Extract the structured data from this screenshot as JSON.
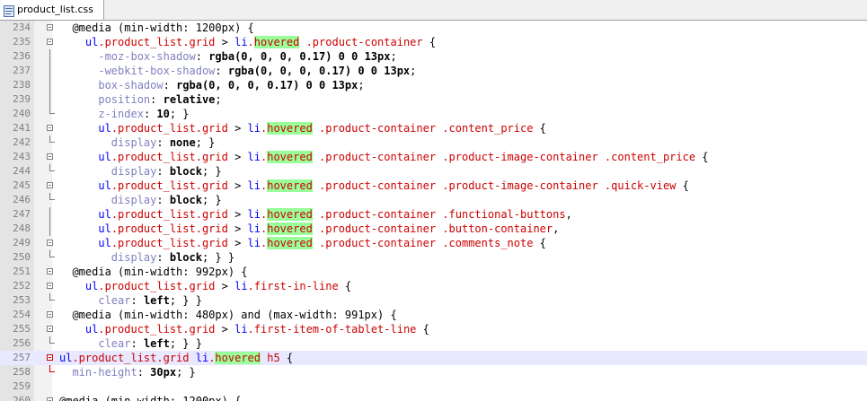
{
  "tab": {
    "label": "product_list.css",
    "icon": "css-file-icon"
  },
  "lines": [
    {
      "num": "234",
      "fold": "box",
      "tokens": [
        [
          "t",
          "  @media (min-width: 1200px) {"
        ]
      ]
    },
    {
      "num": "235",
      "fold": "box",
      "tokens": [
        [
          "t",
          "    "
        ],
        [
          "s",
          "ul"
        ],
        [
          "c",
          ".product_list.grid"
        ],
        [
          "t",
          " > "
        ],
        [
          "s",
          "li"
        ],
        [
          "c",
          "."
        ],
        [
          "h",
          "hovered"
        ],
        [
          "c",
          " .product-container"
        ],
        [
          "t",
          " {"
        ]
      ]
    },
    {
      "num": "236",
      "fold": "line",
      "tokens": [
        [
          "t",
          "      "
        ],
        [
          "p",
          "-moz-box-shadow"
        ],
        [
          "t",
          ": "
        ],
        [
          "v",
          "rgba(0, 0, 0, 0.17) 0 0 13px"
        ],
        [
          "t",
          ";"
        ]
      ]
    },
    {
      "num": "237",
      "fold": "line",
      "tokens": [
        [
          "t",
          "      "
        ],
        [
          "p",
          "-webkit-box-shadow"
        ],
        [
          "t",
          ": "
        ],
        [
          "v",
          "rgba(0, 0, 0, 0.17) 0 0 13px"
        ],
        [
          "t",
          ";"
        ]
      ]
    },
    {
      "num": "238",
      "fold": "line",
      "tokens": [
        [
          "t",
          "      "
        ],
        [
          "p",
          "box-shadow"
        ],
        [
          "t",
          ": "
        ],
        [
          "v",
          "rgba(0, 0, 0, 0.17) 0 0 13px"
        ],
        [
          "t",
          ";"
        ]
      ]
    },
    {
      "num": "239",
      "fold": "line",
      "tokens": [
        [
          "t",
          "      "
        ],
        [
          "p",
          "position"
        ],
        [
          "t",
          ": "
        ],
        [
          "v",
          "relative"
        ],
        [
          "t",
          ";"
        ]
      ]
    },
    {
      "num": "240",
      "fold": "corner",
      "tokens": [
        [
          "t",
          "      "
        ],
        [
          "p",
          "z-index"
        ],
        [
          "t",
          ": "
        ],
        [
          "v",
          "10"
        ],
        [
          "t",
          "; }"
        ]
      ]
    },
    {
      "num": "241",
      "fold": "box",
      "tokens": [
        [
          "t",
          "      "
        ],
        [
          "s",
          "ul"
        ],
        [
          "c",
          ".product_list.grid"
        ],
        [
          "t",
          " > "
        ],
        [
          "s",
          "li"
        ],
        [
          "c",
          "."
        ],
        [
          "h",
          "hovered"
        ],
        [
          "c",
          " .product-container .content_price"
        ],
        [
          "t",
          " {"
        ]
      ]
    },
    {
      "num": "242",
      "fold": "corner",
      "tokens": [
        [
          "t",
          "        "
        ],
        [
          "p",
          "display"
        ],
        [
          "t",
          ": "
        ],
        [
          "v",
          "none"
        ],
        [
          "t",
          "; }"
        ]
      ]
    },
    {
      "num": "243",
      "fold": "box",
      "tokens": [
        [
          "t",
          "      "
        ],
        [
          "s",
          "ul"
        ],
        [
          "c",
          ".product_list.grid"
        ],
        [
          "t",
          " > "
        ],
        [
          "s",
          "li"
        ],
        [
          "c",
          "."
        ],
        [
          "h",
          "hovered"
        ],
        [
          "c",
          " .product-container .product-image-container .content_price"
        ],
        [
          "t",
          " {"
        ]
      ]
    },
    {
      "num": "244",
      "fold": "corner",
      "tokens": [
        [
          "t",
          "        "
        ],
        [
          "p",
          "display"
        ],
        [
          "t",
          ": "
        ],
        [
          "v",
          "block"
        ],
        [
          "t",
          "; }"
        ]
      ]
    },
    {
      "num": "245",
      "fold": "box",
      "tokens": [
        [
          "t",
          "      "
        ],
        [
          "s",
          "ul"
        ],
        [
          "c",
          ".product_list.grid"
        ],
        [
          "t",
          " > "
        ],
        [
          "s",
          "li"
        ],
        [
          "c",
          "."
        ],
        [
          "h",
          "hovered"
        ],
        [
          "c",
          " .product-container .product-image-container .quick-view"
        ],
        [
          "t",
          " {"
        ]
      ]
    },
    {
      "num": "246",
      "fold": "corner",
      "tokens": [
        [
          "t",
          "        "
        ],
        [
          "p",
          "display"
        ],
        [
          "t",
          ": "
        ],
        [
          "v",
          "block"
        ],
        [
          "t",
          "; }"
        ]
      ]
    },
    {
      "num": "247",
      "fold": "line",
      "tokens": [
        [
          "t",
          "      "
        ],
        [
          "s",
          "ul"
        ],
        [
          "c",
          ".product_list.grid"
        ],
        [
          "t",
          " > "
        ],
        [
          "s",
          "li"
        ],
        [
          "c",
          "."
        ],
        [
          "h",
          "hovered"
        ],
        [
          "c",
          " .product-container .functional-buttons"
        ],
        [
          "t",
          ","
        ]
      ]
    },
    {
      "num": "248",
      "fold": "line",
      "tokens": [
        [
          "t",
          "      "
        ],
        [
          "s",
          "ul"
        ],
        [
          "c",
          ".product_list.grid"
        ],
        [
          "t",
          " > "
        ],
        [
          "s",
          "li"
        ],
        [
          "c",
          "."
        ],
        [
          "h",
          "hovered"
        ],
        [
          "c",
          " .product-container .button-container"
        ],
        [
          "t",
          ","
        ]
      ]
    },
    {
      "num": "249",
      "fold": "box",
      "tokens": [
        [
          "t",
          "      "
        ],
        [
          "s",
          "ul"
        ],
        [
          "c",
          ".product_list.grid"
        ],
        [
          "t",
          " > "
        ],
        [
          "s",
          "li"
        ],
        [
          "c",
          "."
        ],
        [
          "h",
          "hovered"
        ],
        [
          "c",
          " .product-container .comments_note"
        ],
        [
          "t",
          " {"
        ]
      ]
    },
    {
      "num": "250",
      "fold": "corner",
      "tokens": [
        [
          "t",
          "        "
        ],
        [
          "p",
          "display"
        ],
        [
          "t",
          ": "
        ],
        [
          "v",
          "block"
        ],
        [
          "t",
          "; } }"
        ]
      ]
    },
    {
      "num": "251",
      "fold": "box",
      "tokens": [
        [
          "t",
          "  @media (min-width: 992px) {"
        ]
      ]
    },
    {
      "num": "252",
      "fold": "box",
      "tokens": [
        [
          "t",
          "    "
        ],
        [
          "s",
          "ul"
        ],
        [
          "c",
          ".product_list.grid"
        ],
        [
          "t",
          " > "
        ],
        [
          "s",
          "li"
        ],
        [
          "c",
          ".first-in-line"
        ],
        [
          "t",
          " {"
        ]
      ]
    },
    {
      "num": "253",
      "fold": "corner",
      "tokens": [
        [
          "t",
          "      "
        ],
        [
          "p",
          "clear"
        ],
        [
          "t",
          ": "
        ],
        [
          "v",
          "left"
        ],
        [
          "t",
          "; } }"
        ]
      ]
    },
    {
      "num": "254",
      "fold": "box",
      "tokens": [
        [
          "t",
          "  @media (min-width: 480px) and (max-width: 991px) {"
        ]
      ]
    },
    {
      "num": "255",
      "fold": "box",
      "tokens": [
        [
          "t",
          "    "
        ],
        [
          "s",
          "ul"
        ],
        [
          "c",
          ".product_list.grid"
        ],
        [
          "t",
          " > "
        ],
        [
          "s",
          "li"
        ],
        [
          "c",
          ".first-item-of-tablet-line"
        ],
        [
          "t",
          " {"
        ]
      ]
    },
    {
      "num": "256",
      "fold": "corner",
      "tokens": [
        [
          "t",
          "      "
        ],
        [
          "p",
          "clear"
        ],
        [
          "t",
          ": "
        ],
        [
          "v",
          "left"
        ],
        [
          "t",
          "; } }"
        ]
      ]
    },
    {
      "num": "257",
      "fold": "boxred",
      "hl": true,
      "tokens": [
        [
          "s",
          "ul"
        ],
        [
          "c",
          ".product_list.grid"
        ],
        [
          "t",
          " "
        ],
        [
          "s",
          "li"
        ],
        [
          "c",
          "."
        ],
        [
          "h",
          "hovered"
        ],
        [
          "c",
          " h5"
        ],
        [
          "t",
          " {"
        ]
      ]
    },
    {
      "num": "258",
      "fold": "cornerred",
      "tokens": [
        [
          "t",
          "  "
        ],
        [
          "p",
          "min-height"
        ],
        [
          "t",
          ": "
        ],
        [
          "v",
          "30px"
        ],
        [
          "t",
          "; }"
        ]
      ]
    },
    {
      "num": "259",
      "fold": "none",
      "tokens": [
        [
          "t",
          ""
        ]
      ]
    },
    {
      "num": "260",
      "fold": "box",
      "tokens": [
        [
          "t",
          "@media (min-width: 1200px) {"
        ]
      ]
    }
  ]
}
